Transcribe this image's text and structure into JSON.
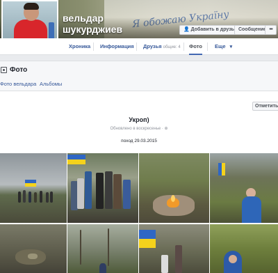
{
  "cover": {
    "writing": "Я обожаю Україну"
  },
  "profile": {
    "name_line1": "вельдар",
    "name_line2": "шукурджиев"
  },
  "actions": {
    "add_friend": "Добавить в друзья",
    "message": "Сообщение",
    "more": "•••"
  },
  "nav": {
    "tabs": [
      {
        "label": "Хроника"
      },
      {
        "label": "Информация"
      },
      {
        "label": "Друзья",
        "sub": "общие: 4"
      },
      {
        "label": "Фото"
      },
      {
        "label": "Еще",
        "suffix": "▾"
      }
    ],
    "active": "Фото"
  },
  "section": {
    "title": "Фото",
    "subtabs": [
      "Фото вельдара",
      "Альбомы"
    ]
  },
  "album": {
    "tag_button": "Отметить",
    "title": "Укроп)",
    "updated": "Обновлено в воскресенье · ⊕",
    "description": "поход 29.03.2015"
  },
  "colors": {
    "link": "#365899",
    "accent": "#4267b2",
    "page_bg": "#e9ebee",
    "flag_blue": "#2f67c4",
    "flag_yellow": "#f4d21c"
  }
}
